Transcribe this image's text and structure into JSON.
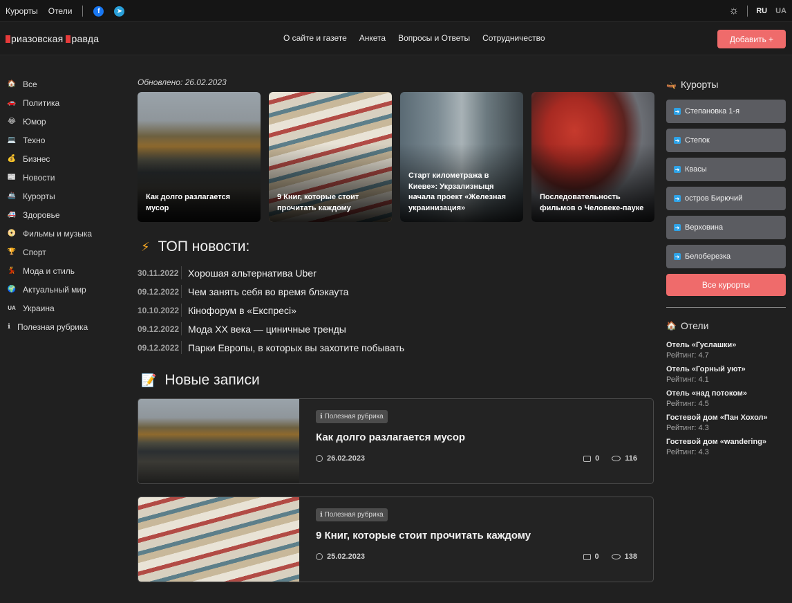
{
  "topbar": {
    "links": [
      "Курорты",
      "Отели"
    ],
    "facebook_icon": "f",
    "telegram_icon": "➤",
    "theme_icon": "☼",
    "lang_ru": "RU",
    "lang_ua": "UA"
  },
  "header": {
    "logo_word1": "риазовская",
    "logo_word2": "равда",
    "nav": [
      "О сайте и газете",
      "Анкета",
      "Вопросы и Ответы",
      "Сотрудничество"
    ],
    "add_label": "Добавить +"
  },
  "sidebar": {
    "items": [
      {
        "icon": "🏠",
        "label": "Все"
      },
      {
        "icon": "🚗",
        "label": "Политика"
      },
      {
        "icon": "😂",
        "label": "Юмор"
      },
      {
        "icon": "💻",
        "label": "Техно"
      },
      {
        "icon": "💰",
        "label": "Бизнес"
      },
      {
        "icon": "📰",
        "label": "Новости"
      },
      {
        "icon": "🚢",
        "label": "Курорты"
      },
      {
        "icon": "🚑",
        "label": "Здоровье"
      },
      {
        "icon": "📀",
        "label": "Фильмы и музыка"
      },
      {
        "icon": "🏆",
        "label": "Спорт"
      },
      {
        "icon": "💃",
        "label": "Мода и стиль"
      },
      {
        "icon": "🌍",
        "label": "Актуальный мир"
      },
      {
        "icon": "UA",
        "label": "Украина"
      },
      {
        "icon": "ℹ",
        "label": "Полезная рубрика"
      }
    ]
  },
  "main": {
    "updated": "Обновлено: 26.02.2023",
    "cards": [
      {
        "title": "Как долго разлагается мусор"
      },
      {
        "title": "9 Книг, которые стоит прочитать каждому"
      },
      {
        "title": "Старт километража в Киеве»: Укрзализныця начала проект «Железная украинизация»"
      },
      {
        "title": "Последовательность фильмов о Человеке-пауке"
      }
    ],
    "top_icon": "⚡",
    "top_title": "ТОП новости:",
    "top_news": [
      {
        "date": "30.11.2022",
        "title": "Хорошая альтернатива Uber"
      },
      {
        "date": "09.12.2022",
        "title": "Чем занять себя во время блэкаута"
      },
      {
        "date": "10.10.2022",
        "title": "Кінофорум в «Експресі»"
      },
      {
        "date": "09.12.2022",
        "title": "Мода XX века — циничные тренды"
      },
      {
        "date": "09.12.2022",
        "title": "Парки Европы, в которых вы захотите побывать"
      }
    ],
    "new_icon": "📝",
    "new_title": "Новые записи",
    "posts": [
      {
        "badge": "ℹ Полезная рубрика",
        "title": "Как долго разлагается мусор",
        "date": "26.02.2023",
        "comments": "0",
        "views": "116"
      },
      {
        "badge": "ℹ Полезная рубрика",
        "title": "9 Книг, которые стоит прочитать каждому",
        "date": "25.02.2023",
        "comments": "0",
        "views": "138"
      }
    ]
  },
  "right": {
    "resorts_icon": "🛶",
    "resorts_title": "Курорты",
    "resorts": [
      "Степановка 1-я",
      "Степок",
      "Квасы",
      "остров Бирючий",
      "Верховина",
      "Белоберезка"
    ],
    "all_resorts": "Все курорты",
    "hotels_icon": "🏠",
    "hotels_title": "Отели",
    "hotels": [
      {
        "name": "Отель «Гуслашки»",
        "rating": "Рейтинг: 4.7"
      },
      {
        "name": "Отель «Горный уют»",
        "rating": "Рейтинг: 4.1"
      },
      {
        "name": "Отель «над потоком»",
        "rating": "Рейтинг: 4.5"
      },
      {
        "name": "Гостевой дом «Пан Хохол»",
        "rating": "Рейтинг: 4.3"
      },
      {
        "name": "Гостевой дом «wandering»",
        "rating": "Рейтинг: 4.3"
      }
    ]
  }
}
